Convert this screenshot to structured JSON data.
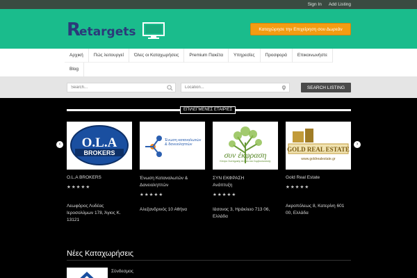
{
  "topbar": {
    "sign_in": "Sign In",
    "add_listing": "Add Listing"
  },
  "header": {
    "logo_initial": "R",
    "logo_rest": "etargets",
    "cta_label": "Καταχώρησε την Επιχείρηση σου Δωρεάν",
    "bg_color": "#1abc8c",
    "cta_color": "#f39c12"
  },
  "nav": {
    "items": [
      "Αρχική",
      "Πώς λειτουργεί",
      "Όλες οι Καταχωρήσεις",
      "Premium Πακέτα",
      "Υπηρεσίες",
      "Προσφορά",
      "Επικοινωνήστε"
    ],
    "blog": "Blog"
  },
  "search": {
    "keyword_placeholder": "Search...",
    "location_placeholder": "Location...",
    "button_label": "SEARCH LISTING"
  },
  "featured": {
    "title": "ΕΠΙΛΕΓΜΕΝΕΣ ΕΤΑΙΡΙΕΣ",
    "listings": [
      {
        "logo_text": "O.L.A",
        "logo_sub": "BROKERS",
        "name": "O.L.A BROKERS",
        "rating": 5,
        "address_line1": "Λεωφόρος Λυδέας",
        "address_line2": "Ιεροσολύμων 178, Άγιος Κ.",
        "address_line3": "13121"
      },
      {
        "logo_text": "Ένωση καταναλωτών & δανειοληπτών",
        "name": "Ένωση Καταναλωτών &",
        "name2": "Δανειοληπτών",
        "rating": 5,
        "address_line1": "Αλεξανδρινός 10 Αθήνα"
      },
      {
        "logo_text": "συν έκφραση",
        "logo_sub": "Κέντρο Συστημικής Ατόμου και Συμβουλευτικής",
        "name": "ΣΥΝ ΕΚΦΡΑΣΗ",
        "name2": "Ανάπτυξη",
        "rating": 5,
        "address_line1": "Ιάσονος 3, Ηράκλειο 713 06,",
        "address_line2": "Ελλάδα"
      },
      {
        "logo_text": "GOLD REAL ESTATE",
        "logo_sub": "www.goldrealestate.gr",
        "name": "Gold Real Estate",
        "rating": 5,
        "address_line1": "Ακροπόλεως 8, Κατερίνη 601",
        "address_line2": "00, Ελλάδα"
      }
    ]
  },
  "new_listings": {
    "title": "Νέες Καταχωρήσεις",
    "first_name": "Σύνδεσμος"
  }
}
